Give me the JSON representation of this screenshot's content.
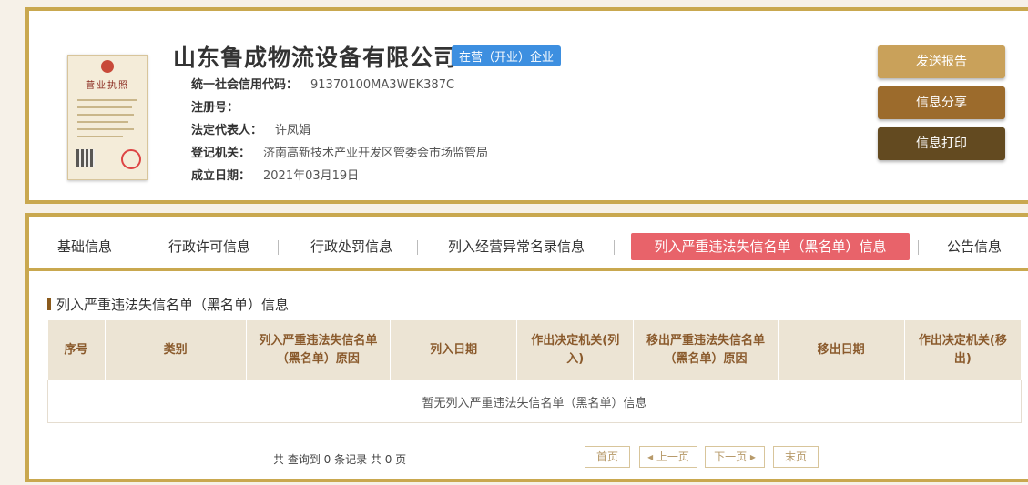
{
  "company": {
    "name": "山东鲁成物流设备有限公司",
    "status": "在营（开业）企业",
    "license_title": "营业执照",
    "fields": [
      {
        "label": "统一社会信用代码：",
        "value": "91370100MA3WEK387C"
      },
      {
        "label": "注册号：",
        "value": ""
      },
      {
        "label": "法定代表人：",
        "value": "许凤娟"
      },
      {
        "label": "登记机关：",
        "value": "济南高新技术产业开发区管委会市场监管局"
      },
      {
        "label": "成立日期：",
        "value": "2021年03月19日"
      }
    ]
  },
  "actions": {
    "report": "发送报告",
    "share": "信息分享",
    "print": "信息打印"
  },
  "tabs": [
    {
      "label": "基础信息"
    },
    {
      "label": "行政许可信息"
    },
    {
      "label": "行政处罚信息"
    },
    {
      "label": "列入经营异常名录信息"
    },
    {
      "label": "列入严重违法失信名单（黑名单）信息",
      "active": true
    },
    {
      "label": "公告信息"
    }
  ],
  "section": {
    "title": "列入严重违法失信名单（黑名单）信息",
    "columns": [
      "序号",
      "类别",
      "列入严重违法失信名单（黑名单）原因",
      "列入日期",
      "作出决定机关(列入)",
      "移出严重违法失信名单（黑名单）原因",
      "移出日期",
      "作出决定机关(移出)"
    ],
    "empty_text": "暂无列入严重违法失信名单（黑名单）信息"
  },
  "pager": {
    "summary": "共 查询到 0 条记录 共 0 页",
    "first": "首页",
    "prev": "◂ 上一页",
    "next": "下一页 ▸",
    "last": "末页"
  },
  "colors": {
    "border_gold": "#c9a84f",
    "active_tab": "#e8636a",
    "badge_blue": "#3d8fe0"
  }
}
